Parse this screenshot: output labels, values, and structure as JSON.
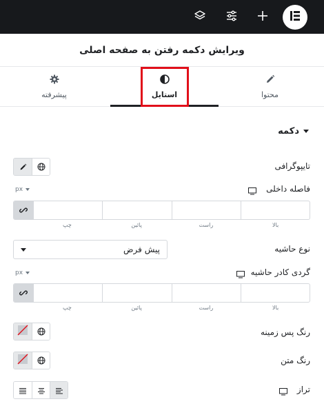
{
  "topbar": {
    "icons": [
      "elementor-logo-icon",
      "plus-icon",
      "sliders-icon",
      "layers-icon"
    ],
    "colors": {
      "background": "#17191c",
      "icon": "#ffffff"
    }
  },
  "panel": {
    "title": "ویرایش دکمه رفتن به صفحه اصلی",
    "tabs": [
      {
        "label": "محتوا",
        "icon": "pencil-icon",
        "active": false
      },
      {
        "label": "استایل",
        "icon": "contrast-icon",
        "active": true
      },
      {
        "label": "پیشرفته",
        "icon": "gear-icon",
        "active": false
      }
    ]
  },
  "section": {
    "title": "دکمه"
  },
  "controls": {
    "typography": {
      "label": "تایپوگرافی"
    },
    "padding": {
      "label": "فاصله داخلی",
      "unit": "px",
      "sides": [
        "بالا",
        "راست",
        "پائین",
        "چپ"
      ]
    },
    "border_type": {
      "label": "نوع حاشیه",
      "value": "پیش فرض"
    },
    "border_radius": {
      "label": "گردی کادر حاشیه",
      "unit": "px",
      "sides": [
        "بالا",
        "راست",
        "پائین",
        "چپ"
      ]
    },
    "background_color": {
      "label": "رنگ پس زمینه"
    },
    "text_color": {
      "label": "رنگ متن"
    },
    "alignment": {
      "label": "تراز"
    }
  },
  "colors": {
    "highlight": "#e10f1a",
    "accent": "#1f2124",
    "border": "#d5d8dc"
  }
}
